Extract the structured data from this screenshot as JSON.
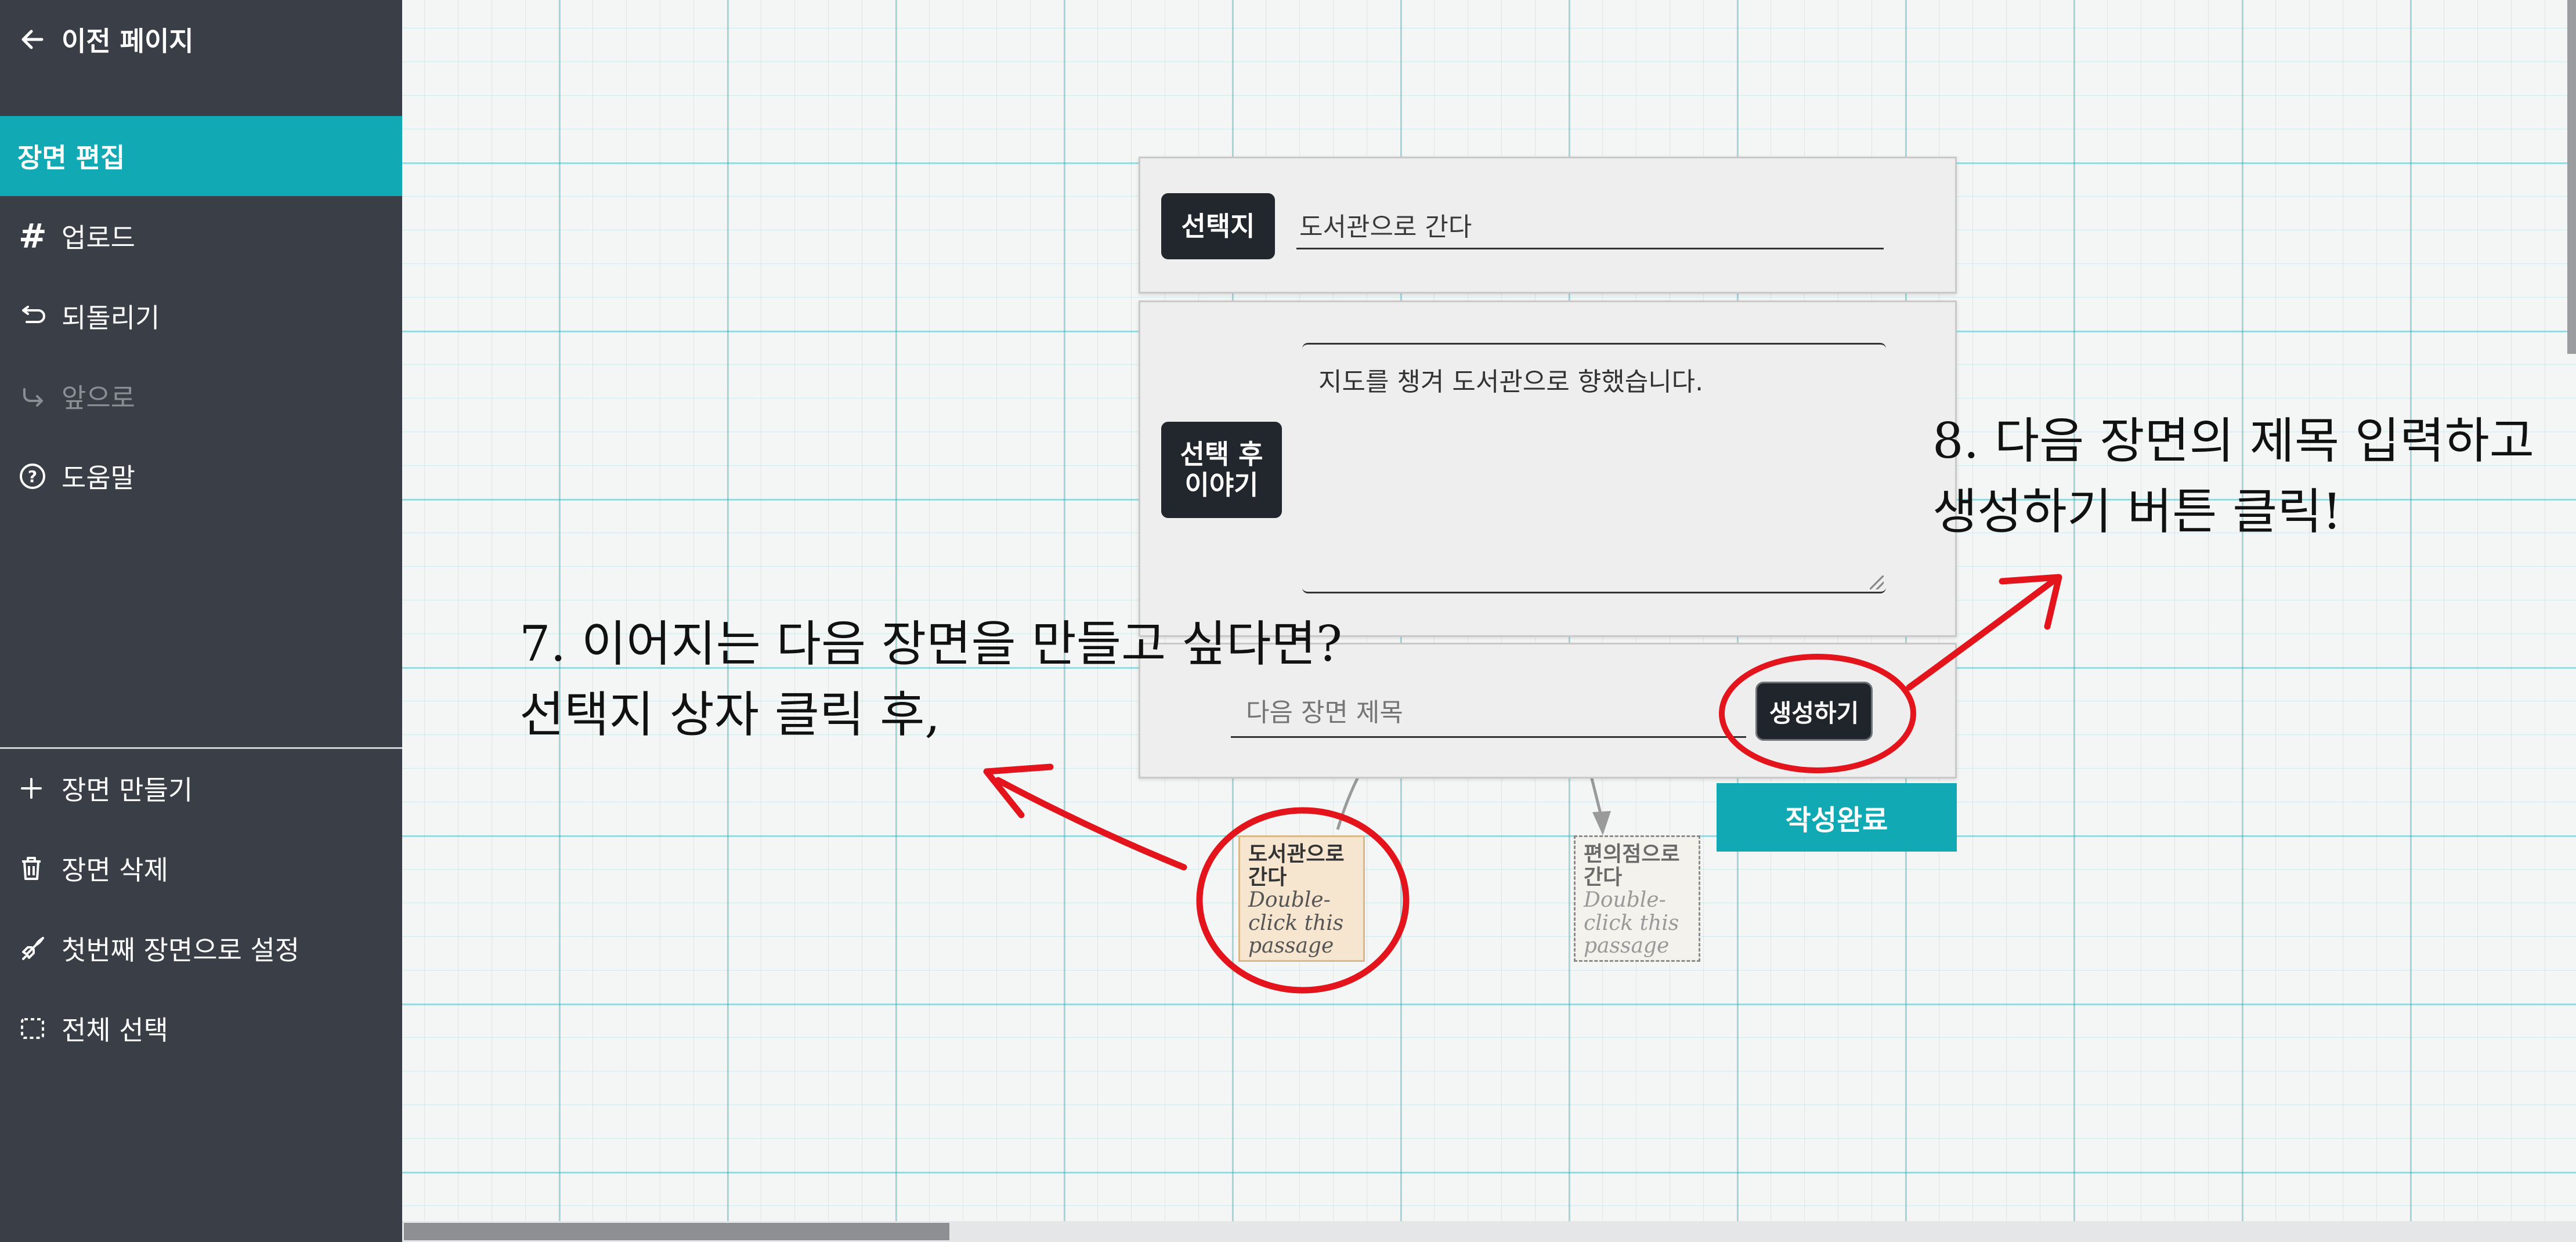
{
  "sidebar": {
    "back": {
      "icon": "arrow-left-icon",
      "label": "이전 페이지"
    },
    "active_section": "장면 편집",
    "tools": [
      {
        "icon": "hash-icon",
        "label": "업로드",
        "enabled": true
      },
      {
        "icon": "undo-icon",
        "label": "되돌리기",
        "enabled": true
      },
      {
        "icon": "redo-icon",
        "label": "앞으로",
        "enabled": false
      },
      {
        "icon": "help-circle-icon",
        "label": "도움말",
        "enabled": true
      }
    ],
    "actions": [
      {
        "icon": "plus-icon",
        "label": "장면 만들기"
      },
      {
        "icon": "trash-icon",
        "label": "장면 삭제"
      },
      {
        "icon": "rocket-icon",
        "label": "첫번째 장면으로 설정"
      },
      {
        "icon": "select-all-icon",
        "label": "전체 선택"
      }
    ]
  },
  "editor": {
    "choice_tag": "선택지",
    "choice_value": "도서관으로 간다",
    "after_story_tag": "선택 후\n이야기",
    "after_story_value": "지도를 챙겨 도서관으로 향했습니다.",
    "next_scene_placeholder": "다음 장면 제목",
    "create_button": "생성하기",
    "done_button": "작성완료"
  },
  "passages": [
    {
      "title": "도서관으로 간다",
      "excerpt": "Double-click this passage"
    },
    {
      "title": "편의점으로 간다",
      "excerpt": "Double-click this passage"
    }
  ],
  "annotations": {
    "step7_line1": "7. 이어지는 다음 장면을 만들고 싶다면?",
    "step7_line2": "선택지 상자 클릭 후,",
    "step8_line1": "8. 다음 장면의 제목 입력하고",
    "step8_line2": "생성하기 버튼 클릭!",
    "ink_color": "#e3141b"
  },
  "colors": {
    "sidebar_bg": "#3a3f47",
    "accent": "#10a9b4",
    "dark_button": "#22272e"
  }
}
